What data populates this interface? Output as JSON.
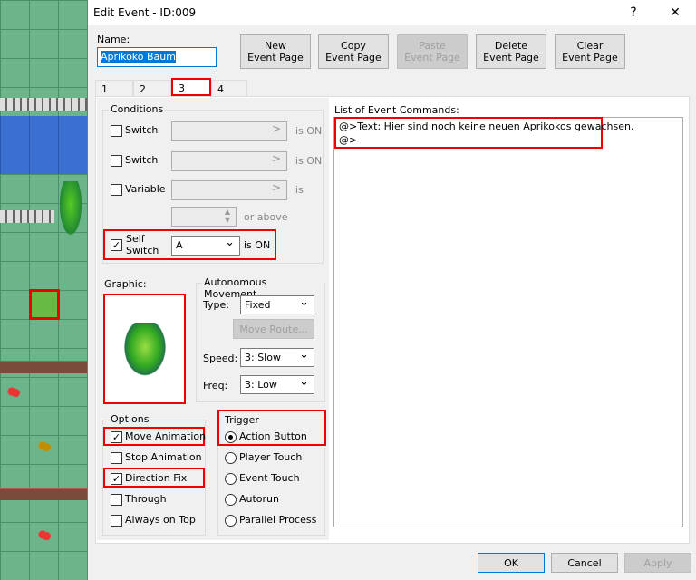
{
  "window": {
    "title": "Edit Event - ID:009",
    "help": "?",
    "close": "✕"
  },
  "name": {
    "label": "Name:",
    "value": "Aprikoko Baum"
  },
  "buttons": {
    "new": "New\nEvent Page",
    "copy": "Copy\nEvent Page",
    "paste": "Paste\nEvent Page",
    "delete": "Delete\nEvent Page",
    "clear": "Clear\nEvent Page"
  },
  "tabs": [
    "1",
    "2",
    "3",
    "4"
  ],
  "active_tab": "3",
  "conditions": {
    "label": "Conditions",
    "switch1": "Switch",
    "switch2": "Switch",
    "variable": "Variable",
    "is_on": "is ON",
    "is": "is",
    "or_above": "or above",
    "self_switch": "Self\nSwitch",
    "self_switch_value": "A",
    "self_is_on": "is ON",
    "self_checked": true
  },
  "graphic": {
    "label": "Graphic:"
  },
  "movement": {
    "label": "Autonomous Movement",
    "type_label": "Type:",
    "type": "Fixed",
    "move_route": "Move Route...",
    "speed_label": "Speed:",
    "speed": "3: Slow",
    "freq_label": "Freq:",
    "freq": "3: Low"
  },
  "options": {
    "label": "Options",
    "items": [
      {
        "label": "Move Animation",
        "checked": true
      },
      {
        "label": "Stop Animation",
        "checked": false
      },
      {
        "label": "Direction Fix",
        "checked": true
      },
      {
        "label": "Through",
        "checked": false
      },
      {
        "label": "Always on Top",
        "checked": false
      }
    ]
  },
  "trigger": {
    "label": "Trigger",
    "items": [
      {
        "label": "Action Button",
        "selected": true
      },
      {
        "label": "Player Touch",
        "selected": false
      },
      {
        "label": "Event Touch",
        "selected": false
      },
      {
        "label": "Autorun",
        "selected": false
      },
      {
        "label": "Parallel Process",
        "selected": false
      }
    ]
  },
  "commands": {
    "label": "List of Event Commands:",
    "lines": [
      "@>Text: Hier sind noch keine neuen Aprikokos gewachsen.",
      "@>"
    ]
  },
  "footer": {
    "ok": "OK",
    "cancel": "Cancel",
    "apply": "Apply"
  }
}
